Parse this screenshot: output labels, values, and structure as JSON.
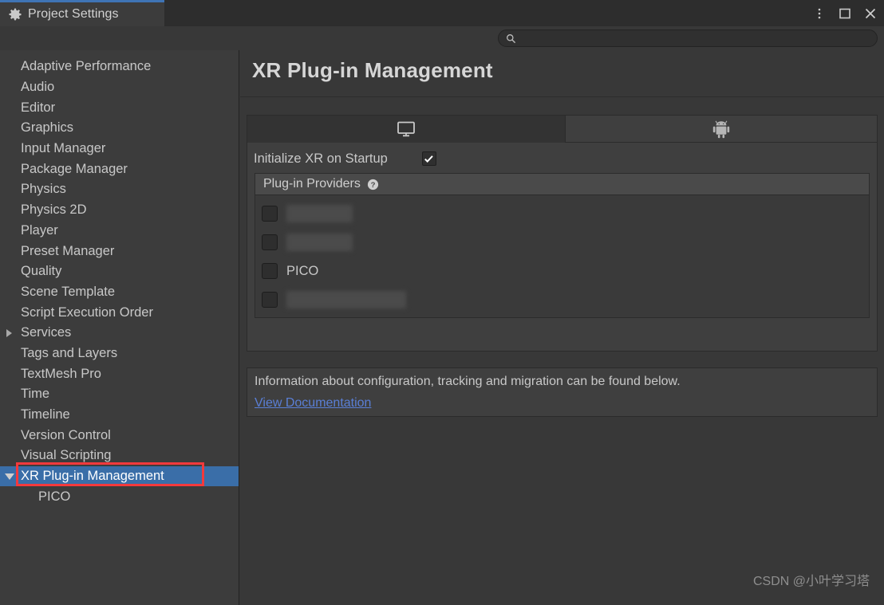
{
  "window": {
    "tab_title": "Project Settings",
    "gear_icon": "gear-icon",
    "menu_icon": "kebab-menu-icon",
    "maximize_icon": "maximize-icon",
    "close_icon": "close-icon"
  },
  "search": {
    "placeholder": "",
    "value": "",
    "icon": "search-icon"
  },
  "sidebar": {
    "items": [
      {
        "label": "Adaptive Performance",
        "arrow": "none",
        "selected": false,
        "child": false
      },
      {
        "label": "Audio",
        "arrow": "none",
        "selected": false,
        "child": false
      },
      {
        "label": "Editor",
        "arrow": "none",
        "selected": false,
        "child": false
      },
      {
        "label": "Graphics",
        "arrow": "none",
        "selected": false,
        "child": false
      },
      {
        "label": "Input Manager",
        "arrow": "none",
        "selected": false,
        "child": false
      },
      {
        "label": "Package Manager",
        "arrow": "none",
        "selected": false,
        "child": false
      },
      {
        "label": "Physics",
        "arrow": "none",
        "selected": false,
        "child": false
      },
      {
        "label": "Physics 2D",
        "arrow": "none",
        "selected": false,
        "child": false
      },
      {
        "label": "Player",
        "arrow": "none",
        "selected": false,
        "child": false
      },
      {
        "label": "Preset Manager",
        "arrow": "none",
        "selected": false,
        "child": false
      },
      {
        "label": "Quality",
        "arrow": "none",
        "selected": false,
        "child": false
      },
      {
        "label": "Scene Template",
        "arrow": "none",
        "selected": false,
        "child": false
      },
      {
        "label": "Script Execution Order",
        "arrow": "none",
        "selected": false,
        "child": false
      },
      {
        "label": "Services",
        "arrow": "collapsed",
        "selected": false,
        "child": false
      },
      {
        "label": "Tags and Layers",
        "arrow": "none",
        "selected": false,
        "child": false
      },
      {
        "label": "TextMesh Pro",
        "arrow": "none",
        "selected": false,
        "child": false
      },
      {
        "label": "Time",
        "arrow": "none",
        "selected": false,
        "child": false
      },
      {
        "label": "Timeline",
        "arrow": "none",
        "selected": false,
        "child": false
      },
      {
        "label": "Version Control",
        "arrow": "none",
        "selected": false,
        "child": false
      },
      {
        "label": "Visual Scripting",
        "arrow": "none",
        "selected": false,
        "child": false
      },
      {
        "label": "XR Plug-in Management",
        "arrow": "expanded",
        "selected": true,
        "child": false
      },
      {
        "label": "PICO",
        "arrow": "none",
        "selected": false,
        "child": true
      }
    ]
  },
  "main": {
    "page_title": "XR Plug-in Management",
    "platform_tabs": [
      {
        "icon": "desktop-monitor-icon",
        "active": true,
        "name": "standalone"
      },
      {
        "icon": "android-robot-icon",
        "active": false,
        "name": "android"
      }
    ],
    "initialize_xr": {
      "label": "Initialize XR on Startup",
      "checked": true
    },
    "providers": {
      "header": "Plug-in Providers",
      "help_icon": "help-circle-icon",
      "rows": [
        {
          "label": "",
          "checked": false,
          "blurred": true
        },
        {
          "label": "",
          "checked": false,
          "blurred": true
        },
        {
          "label": "PICO",
          "checked": false,
          "blurred": false
        },
        {
          "label": "",
          "checked": false,
          "blurred": true
        }
      ]
    },
    "info": {
      "text": "Information about configuration, tracking and migration can be found below.",
      "link": "View Documentation"
    }
  },
  "annotations": {
    "colors": {
      "highlight": "#f4393c",
      "selection": "#3a6ea8",
      "link": "#5a7fd6"
    }
  },
  "watermark": "CSDN @小叶学习塔"
}
